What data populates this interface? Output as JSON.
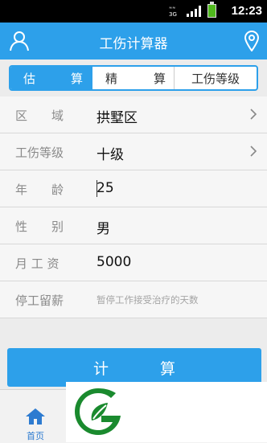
{
  "status_bar": {
    "network_label": "3G",
    "time": "12:23"
  },
  "header": {
    "title": "工伤计算器"
  },
  "tabs": [
    {
      "label_a": "估",
      "label_b": "算",
      "active": true
    },
    {
      "label_a": "精",
      "label_b": "算",
      "active": false
    },
    {
      "label": "工伤等级",
      "active": false
    }
  ],
  "form": {
    "region": {
      "label": "区　　域",
      "value": "拱墅区"
    },
    "injury_level": {
      "label": "工伤等级",
      "value": "十级"
    },
    "age": {
      "label": "年　　龄",
      "value": "25"
    },
    "gender": {
      "label": "性　　别",
      "value": "男"
    },
    "monthly_salary": {
      "label": "月 工 资",
      "value": "5000"
    },
    "suspension": {
      "label": "停工留薪",
      "placeholder": "暂停工作接受治疗的天数"
    }
  },
  "calculate_button": {
    "char_a": "计",
    "char_b": "算"
  },
  "bottom_nav": {
    "home_label": "首页"
  },
  "colors": {
    "primary": "#2da0ea",
    "logo_green": "#1a8a2e"
  }
}
